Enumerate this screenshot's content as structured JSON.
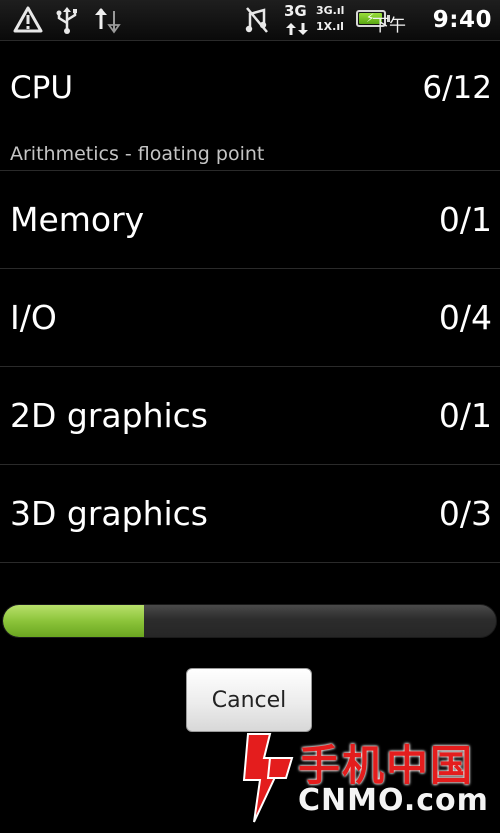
{
  "status_bar": {
    "icons": [
      "alert-triangle-icon",
      "usb-icon",
      "data-transfer-icon",
      "vibrate-icon",
      "network-3g-icon",
      "signal-icon",
      "battery-charging-icon"
    ],
    "network_3g": "3G",
    "signal_top": "3G.ıl",
    "signal_bottom": "1X.ıl",
    "ampm": "下午",
    "time": "9:40",
    "battery_fill_color": "#7cc52a"
  },
  "benchmark": {
    "header": {
      "label": "CPU",
      "value": "6/12"
    },
    "current_test": "Arithmetics - floating point",
    "categories": [
      {
        "label": "Memory",
        "value": "0/1"
      },
      {
        "label": "I/O",
        "value": "0/4"
      },
      {
        "label": "2D graphics",
        "value": "0/1"
      },
      {
        "label": "3D graphics",
        "value": "0/3"
      }
    ],
    "progress": 0.285,
    "progress_color": "#8cc43a",
    "cancel_label": "Cancel"
  },
  "watermark": {
    "cn_text": "手机中国",
    "en_text": "CNMO.com",
    "brand_color": "#e41d1d"
  }
}
